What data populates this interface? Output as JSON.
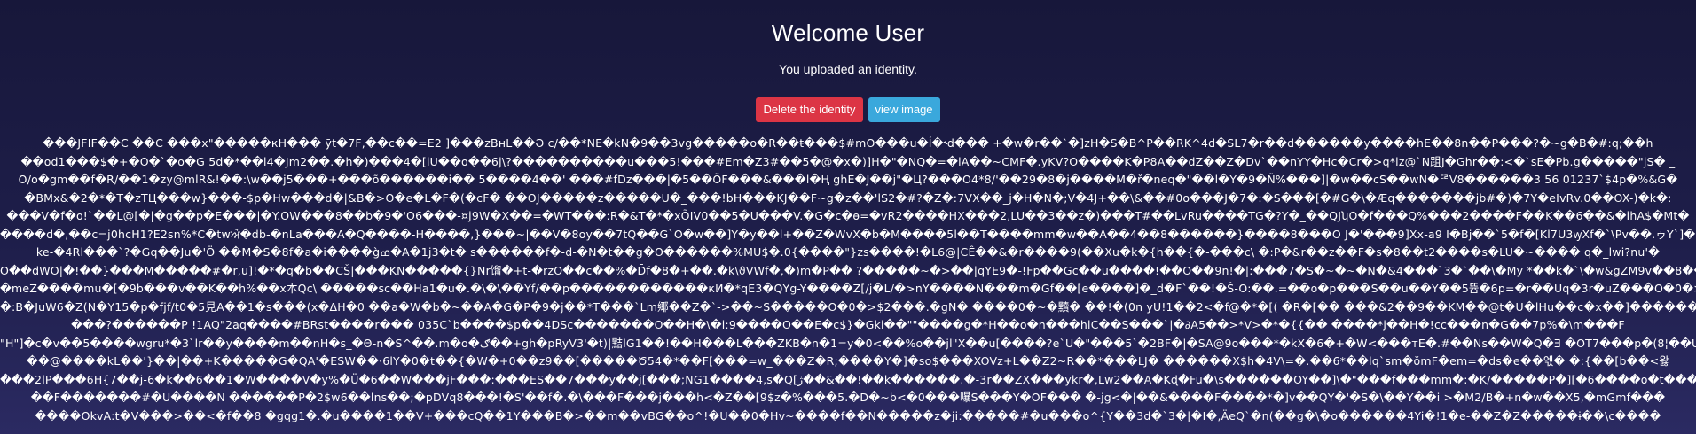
{
  "header": {
    "title": "Welcome User",
    "subtitle": "You uploaded an identity."
  },
  "actions": {
    "delete_label": "Delete the identity",
    "view_label": "view image",
    "delete_color": "#dc3545",
    "view_color": "#3aa8dc"
  },
  "binary_dump": {
    "lines": [
      "���JFIF��C    ��C    ���x\"�����кH��� ӯt�7F,��c��=E2 ]���zBнL��Ə c/��*NE�kN�9��3vg�����o�R��ŧ���$#mO���u�Í�˞d��� +�w�r��`�]zH�S�B^P��RK^4d�SL7�r��d������y����hE��8n��P���?�~g�B�#:q;��h",
      "��od1���$�+�O�`�o�G 5d�*��l4�Jm2��.�h�)���4�[iU��o��6j\\?����������u���5!���#Em�Z3#��5�@�x�)]H�\"�NQ�=�lA��~CMF�.yKV?O����K�P8A��dZ��Z�Dv`��nYY�Hc�Cr�>q*lz@`N跙J�Ghr��:<�`sE�Pb.g�����\"jS� _",
      "O/o�gm��f�R/��1�zy@mlR&!��:\\w��j5���+���õ������i�� 5����4��' ���#fDz���|�5��ÕF���&���l�Ң ghE�J��j\"�Ц?���O4*8/'��29�8�j����M�ř�neq�\"��l�Y�9�Ñ%���]|�w��cS��wN�ᅞV8������3 56 01237`$4p�%&G�",
      "�BMx&�2�*�T�zТЦ���w}���-$p�Hw���d�|&B�>O�e�L�F�(�cF� ��OJ�����z�����U�_���!bH���KJ��F~g�z��'lS2�#?�Z�:7VX��_j�H�N�;V�4J+��\\&��#0o���J�7�:�S���[�#G�\\�Æq�������jb#�)�7Y�eIvRv.0��OX-)�k�:",
      "���V�f�o!`��L@[�|�g��p�E���|�Y.OW���8��b�9�'O6���-¤j9W�X��=�WT���:R�&T�*�xÕIV0��5�U���V.�G�c�ɵ=�vR2����HX���2,LU��3��z�)���T#��LvRu����TG�?Y�_��QJʮO�f���Q%���2����F��K��6��&�ihA$�Mt�",
      "����d�,��c=j0hcH1?E2sn%*C�twਔ�db-�nLa���A�Q����-H����,}���~|��V�8oy��7tQ��G`O�w��]Y�y��l+��Z�WvX�b�M����5l��T����mm�w��A��4��8������}����8���O J�'���9]Xx-a9 I�Bj��`5�f�[Kl7U3ꝡXf�`\\Pv��.ゥY`]�.}",
      "ke-�4Rl���`?�Gq��Ju�'Ö ��M�S�8f�a�i����g̀ߘ�A�1j3�t� s������f�-d-�N�t��g�O������%MU$�.0{����\"}zs����!�L6@|CÊ��&�r����9(��Xu�k�{h��{�-���c\\ �:P�&r��z��F�s�8��t2����s�LU�~���� q�_lwi?nu'�",
      "O��dWO|�!��}���M�����#�r,u]!�*�q�b��CŠ|���KN�����{}Nr馏�+t-�rzO��c��%�D̄f�8�+��.�k\\ϑVWf�,�)m�P�� ?�����~�>��|qYE9�-!Fp��Gc��u����!��O��9n!�|:���7�S�~�~�N�&4���`3�`��\\�My *��k�`\\�w&gZM9v��8��hu���/",
      "�meZ����mu�[�9b���v��K��h%��x本Qc\\ �����sc��Hа1�u�.�\\�\\��Yf/��p������������кИ�*qE3�QYg-Y����Z[/j�L/�>nY����N���m�Gf��[e����]�_d�F`��!�Ŝ-O:��.=��o�p���S��u��Y��5뜝�6p=�r��Uq�3r�uZ���O�0�>$2�",
      "�:B�JuW6�Z(N�Y15�p�fjf/t0�5見A��1�s���(x�ΔH�0 ��a�W�b�~��A�G�P�9�j��*T���`Lm鄊��Z�`->��~S�����O�0�>$2���.�gN� ����0�~�黷� ��!�(0n yU!1��2<�f@�*�[( �R�[�� ���&2��9��KM��@t�U�lHu��c�x��]�������",
      "���?������P !1AQ\"2aq����#BRst����r��� 035C`b����$p��4DSc�������O��H�\\�i:9����O��E�c$}�Gki��\"\"����g�*H��o�n���hlC��S���`|�∂A5��>*V>�*�{{�� ����*j��H�!cc���n�G��7p%�\\m���F",
      "\"H\"]�c�v��5����wgrս*�3`lr��y����m��nH�s_�Θ-n�S^��.m�o�ګ��+gh�pRyV3'�t)|黠lG1��!��H���L���ZKB�n�1=y�0<��%o��jl\"X��u[����?e`U�\"���5`�2BF�|�SA@9o���*�kX�6�+�W<���тE�.#��Ns��W�Q�Ǝ �OT7���p�(8¦��U��",
      "��@����kL��'}��|��+K�����G�QA'�ESW��·6lY�0�t��{�W�+0��z9��[�����Ծ54�*��F[���=w_���Z�R;����Y�]�so$���XOVz+L��Z2~R��*���LJ� ������X$h�4V\\=�.��6*��lq`sm�ŏmF�em=�ds�e��엓� �:{��[b��<왏",
      "���2lP���6H{7��j-6�k��6��1�W����V�y%�Ü�6��W���jF���:���ES��7���y��j[���;NG1����4,s�Q[ژ��&��!��k������.�-3r��ZX���ykr�,Lw2��A�Kɖ�Fu�\\s������OY��]\\�\"���f���mm�:�K/�����P�][�6����o�t���y�",
      "��F�������#�U����N ������P�2$w6��lns��;�pDVq8���!�S'��f�.�\\���F���j���h<�Z��[9$z�%���5.�D�~b<�0���嚗S���Y�OF��� �-jg<�|��&����F����*�]v��QY�'�S�\\��Y��i >�M2/B�+n�w��X5,�mGmf���",
      "����OkvA:t�V���>��<�f��8 �gqg1�.�u����1��V+���cQ��1Y���B�>��m��vBG��o^!�U��0�Hv~����f��N�����z�ji:�����#�u���o^{Y��3d�`3�|�I�,ÄeQ`�n(��g�\\�o������4Yi�!1�e-��Z�Z�����ɨ��\\c����"
    ]
  }
}
